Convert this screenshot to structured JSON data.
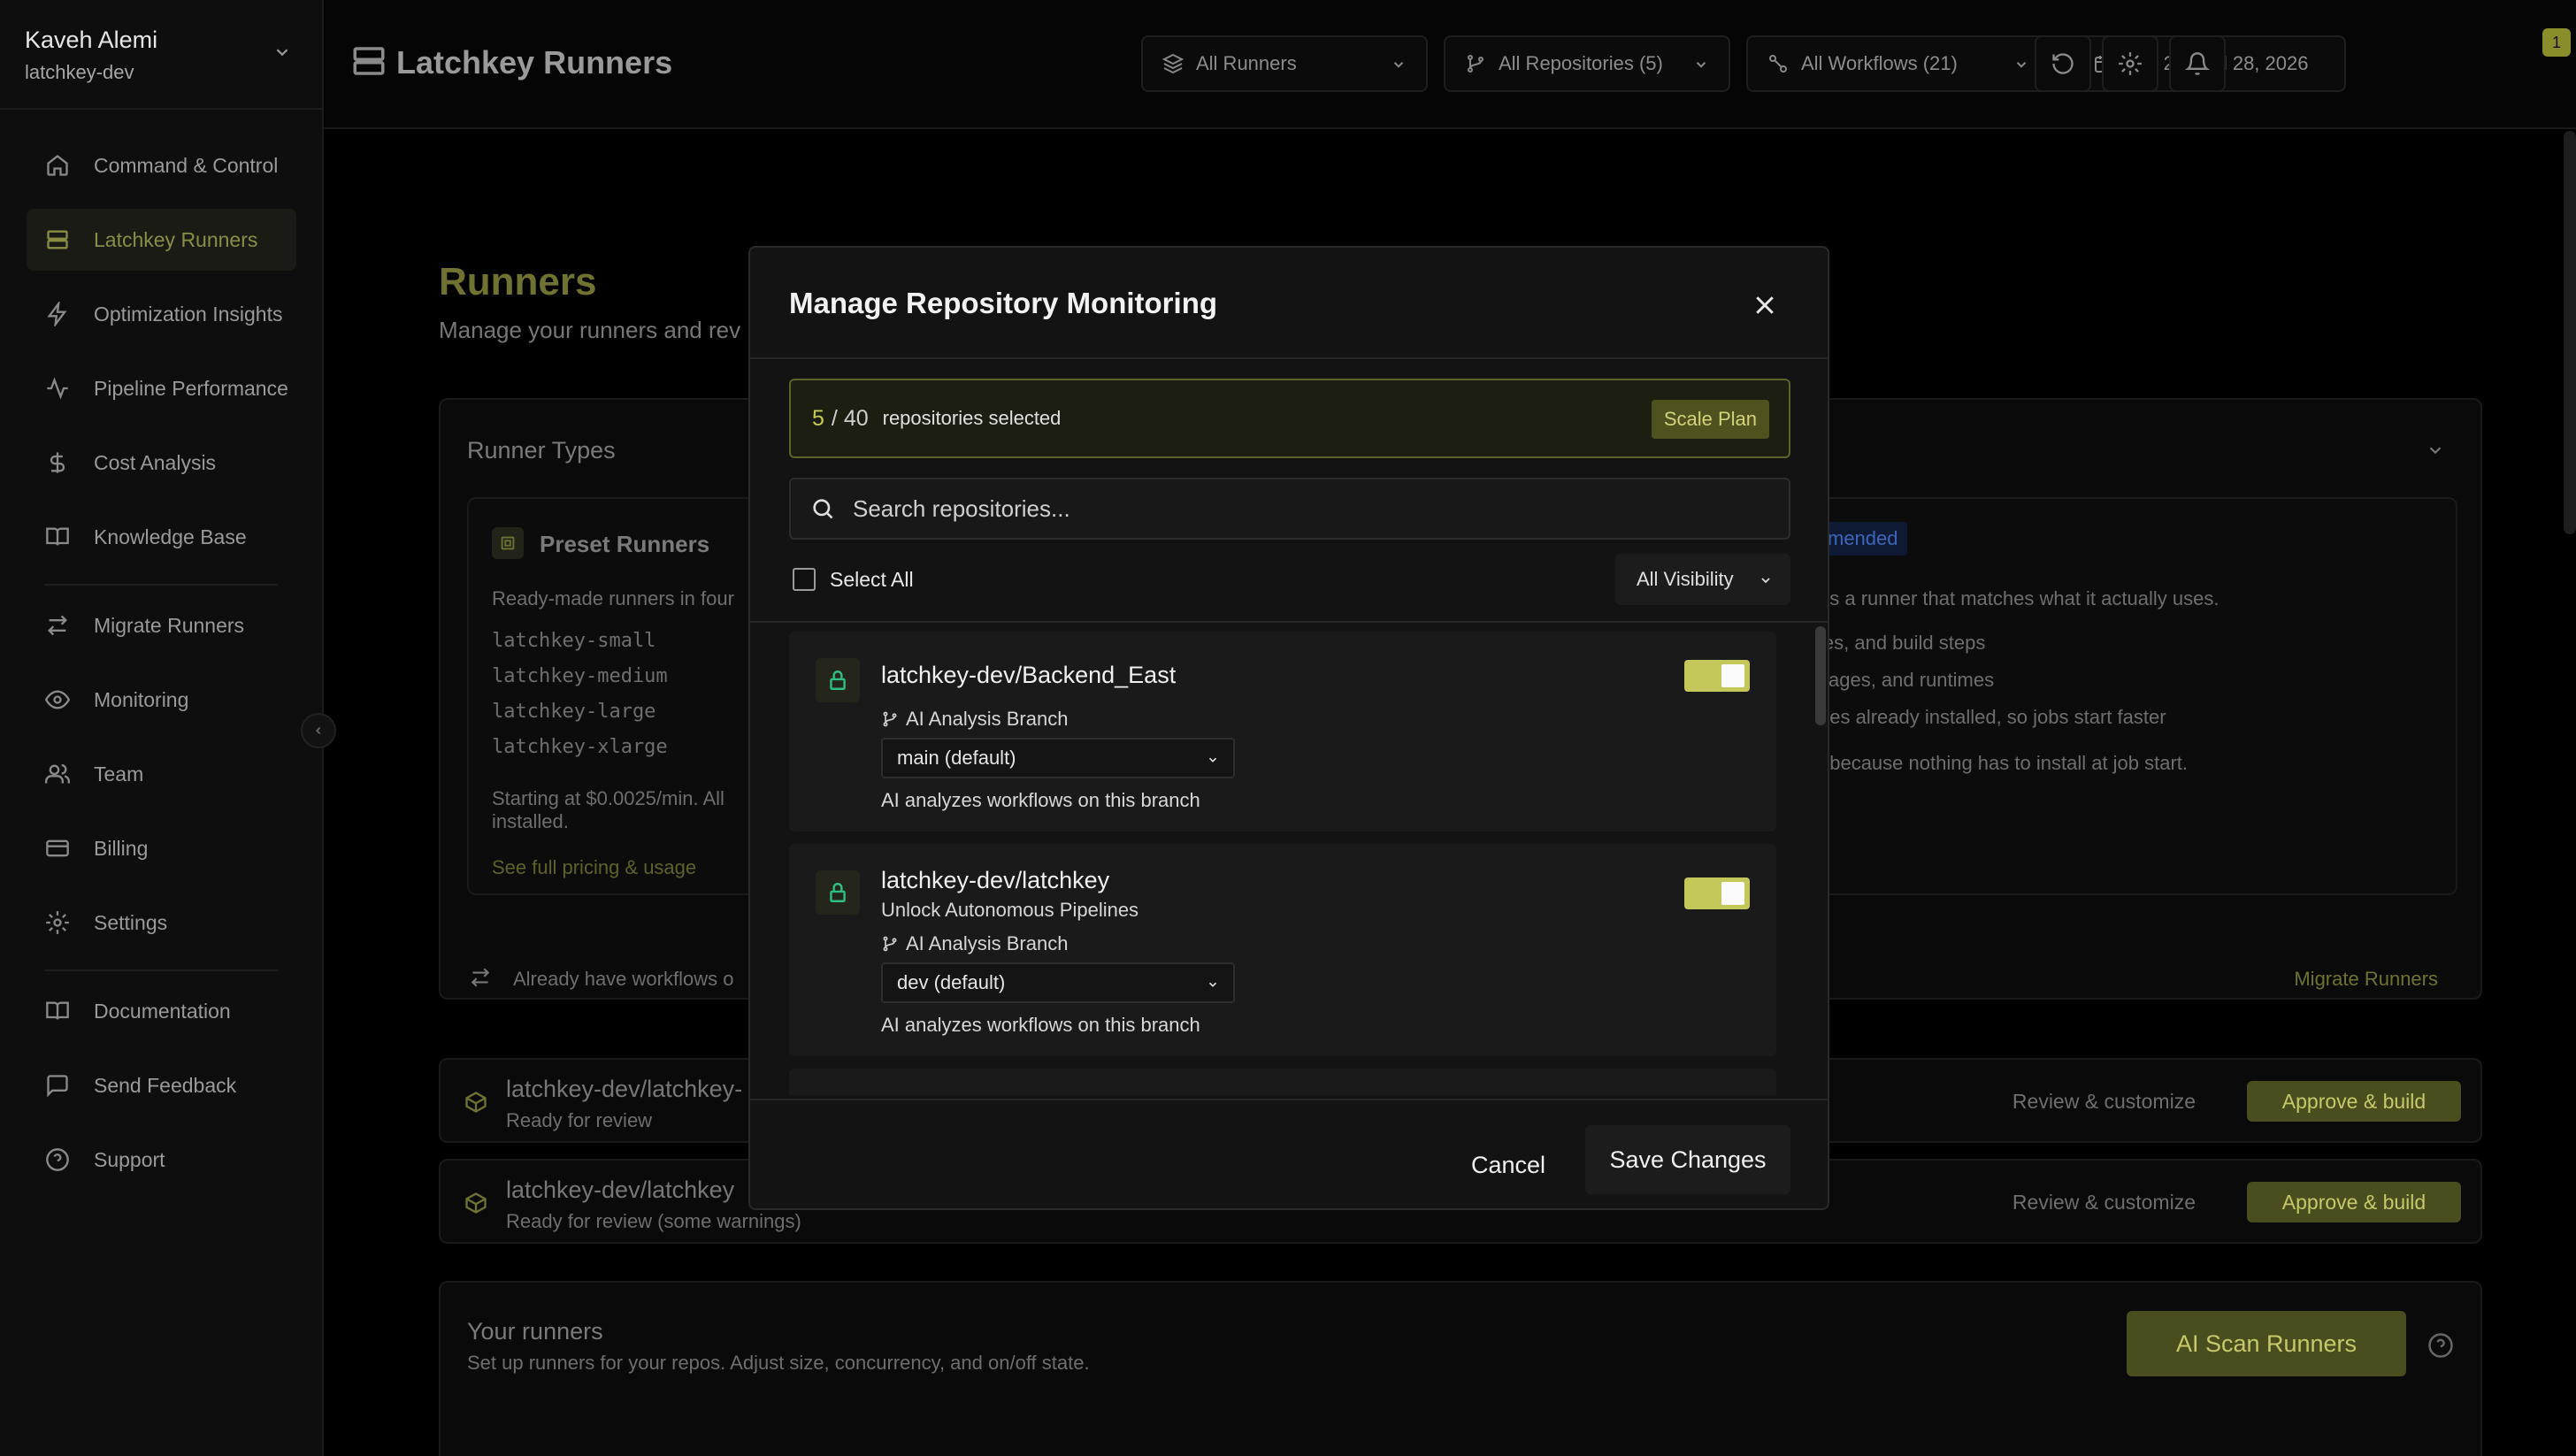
{
  "org": {
    "user": "Kaveh Alemi",
    "team": "latchkey-dev"
  },
  "sidebar": {
    "items": [
      {
        "label": "Command & Control",
        "icon": "home-icon"
      },
      {
        "label": "Latchkey Runners",
        "icon": "server-icon",
        "active": true
      },
      {
        "label": "Optimization Insights",
        "icon": "bolt-icon"
      },
      {
        "label": "Pipeline Performance",
        "icon": "activity-icon"
      },
      {
        "label": "Cost Analysis",
        "icon": "dollar-icon"
      },
      {
        "label": "Knowledge Base",
        "icon": "book-icon"
      },
      {
        "label": "Migrate Runners",
        "icon": "swap-icon"
      },
      {
        "label": "Monitoring",
        "icon": "eye-icon"
      },
      {
        "label": "Team",
        "icon": "users-icon"
      },
      {
        "label": "Billing",
        "icon": "card-icon"
      },
      {
        "label": "Settings",
        "icon": "gear-icon"
      },
      {
        "label": "Documentation",
        "icon": "book-icon"
      },
      {
        "label": "Send Feedback",
        "icon": "message-icon"
      },
      {
        "label": "Support",
        "icon": "help-icon"
      }
    ]
  },
  "header": {
    "title": "Latchkey Runners",
    "filters": {
      "runners": "All Runners",
      "repos": "All Repositories (5)",
      "workflows": "All Workflows (21)",
      "dates": "Jun 29 - Jul 28, 2026"
    },
    "notifications": "1"
  },
  "page": {
    "title": "Runners",
    "subtitle": "Manage your runners and rev",
    "runner_types": {
      "title": "Runner Types",
      "preset_title": "Preset Runners",
      "preset_desc": "Ready-made runners in four",
      "sizes": [
        "latchkey-small",
        "latchkey-medium",
        "latchkey-large",
        "latchkey-xlarge"
      ],
      "pricing_1": "Starting at $0.0025/min. All",
      "pricing_2": "installed.",
      "pricing_link": "See full pricing & usage",
      "recommended": "mended",
      "right_desc": "ds a runner that matches what it actually uses.",
      "right_items": [
        "ies, and build steps",
        "kages, and runtimes",
        "ges already installed, so jobs start faster"
      ],
      "right_note": ", because nothing has to install at job start.",
      "already_have": "Already have workflows o",
      "migrate_link": "Migrate Runners"
    },
    "pending": [
      {
        "name": "latchkey-dev/latchkey-",
        "status": "Ready for review"
      },
      {
        "name": "latchkey-dev/latchkey",
        "status": "Ready for review (some warnings)"
      }
    ],
    "review_label": "Review & customize",
    "approve_label": "Approve & build",
    "your_runners": {
      "title": "Your runners",
      "desc": "Set up runners for your repos. Adjust size, concurrency, and on/off state.",
      "scan_label": "AI Scan Runners"
    }
  },
  "modal": {
    "title": "Manage Repository Monitoring",
    "selected": "5",
    "total": "40",
    "selected_text": "repositories selected",
    "plan": "Scale Plan",
    "search_placeholder": "Search repositories...",
    "select_all": "Select All",
    "visibility": "All Visibility",
    "branch_label": "AI Analysis Branch",
    "branch_help": "AI analyzes workflows on this branch",
    "repos": [
      {
        "name": "latchkey-dev/Backend_East",
        "description": "",
        "branch": "main (default)",
        "enabled": true
      },
      {
        "name": "latchkey-dev/latchkey",
        "description": "Unlock Autonomous Pipelines",
        "branch": "dev (default)",
        "enabled": true
      }
    ],
    "cancel": "Cancel",
    "save": "Save Changes"
  },
  "colors": {
    "accent": "#c4c759",
    "olive": "#4a4d1e",
    "background": "#000000",
    "modal": "#131313"
  }
}
